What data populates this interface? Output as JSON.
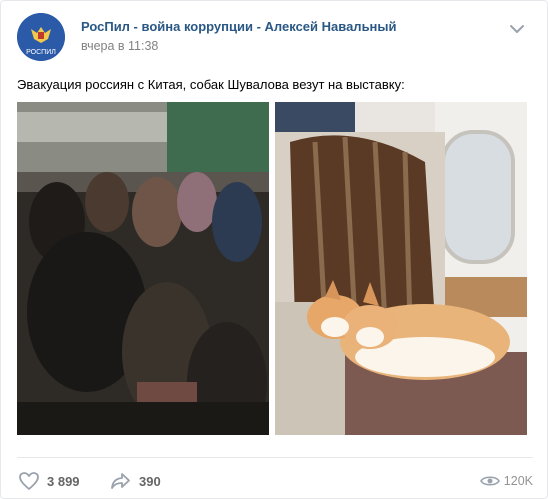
{
  "post": {
    "author": "РосПил - война коррупции - Алексей Навальный",
    "time": "вчера в 11:38",
    "avatar_caption": "РОСПИЛ",
    "text": "Эвакуация россиян с Китая, собак Шувалова везут на выставку:",
    "photos": [
      {
        "description_icon": "evacuation-plane-photo"
      },
      {
        "description_icon": "corgi-jet-photo"
      }
    ]
  },
  "footer": {
    "likes": "3 899",
    "shares": "390",
    "views": "120K"
  },
  "colors": {
    "author_link": "#2a5885",
    "muted": "#828282",
    "icon": "#99a2ad",
    "avatar_bg": "#2b5aa8"
  }
}
